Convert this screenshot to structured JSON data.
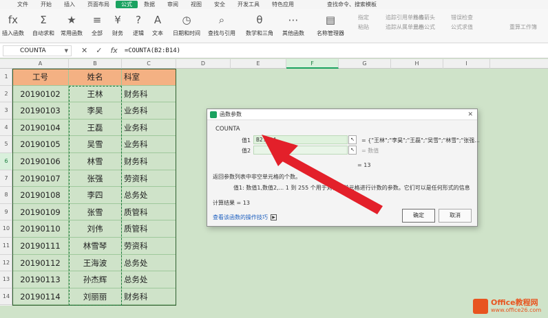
{
  "menubar": {
    "items": [
      "文件",
      "开始",
      "插入",
      "页面布局",
      "公式",
      "数据",
      "审阅",
      "视图",
      "安全",
      "开发工具",
      "特色应用"
    ],
    "active_index": 4,
    "search_text": "查找命令、搜索模板"
  },
  "toolbar": {
    "buttons": [
      {
        "label": "插入函数",
        "icon": "fx-icon",
        "glyph": "fx"
      },
      {
        "label": "自动求和",
        "icon": "sum-icon",
        "glyph": "Σ"
      },
      {
        "label": "常用函数",
        "icon": "star-icon",
        "glyph": "★"
      },
      {
        "label": "全部",
        "icon": "list-icon",
        "glyph": "≡"
      },
      {
        "label": "财务",
        "icon": "finance-icon",
        "glyph": "¥"
      },
      {
        "label": "逻辑",
        "icon": "logic-icon",
        "glyph": "?"
      },
      {
        "label": "文本",
        "icon": "text-icon",
        "glyph": "A"
      },
      {
        "label": "日期和时间",
        "icon": "clock-icon",
        "glyph": "◷"
      },
      {
        "label": "查找与引用",
        "icon": "search-icon",
        "glyph": "⌕"
      },
      {
        "label": "数学和三角",
        "icon": "math-icon",
        "glyph": "θ"
      },
      {
        "label": "其他函数",
        "icon": "more-icon",
        "glyph": "⋯"
      },
      {
        "label": "名称管理器",
        "icon": "name-icon",
        "glyph": "▤"
      }
    ],
    "small_items": [
      "指定",
      "粘贴",
      "追踪引用单元格",
      "追踪从属单元格",
      "移去箭头",
      "显示公式",
      "错误检查",
      "公式求值",
      "重算工作簿"
    ]
  },
  "formula_bar": {
    "name_box": "COUNTA",
    "formula": "=COUNTA(B2:B14)"
  },
  "grid": {
    "columns": [
      "A",
      "B",
      "C",
      "D",
      "E",
      "F",
      "G",
      "H",
      "I"
    ],
    "selected_column": "F",
    "rows": [
      "1",
      "2",
      "3",
      "4",
      "5",
      "6",
      "7",
      "8",
      "9",
      "10",
      "11",
      "12",
      "13",
      "14"
    ],
    "selected_row": "6",
    "header": [
      "工号",
      "姓名",
      "科室"
    ],
    "data": [
      [
        "20190102",
        "王林",
        "财务科"
      ],
      [
        "20190103",
        "李昊",
        "业务科"
      ],
      [
        "20190104",
        "王磊",
        "业务科"
      ],
      [
        "20190105",
        "吴雪",
        "业务科"
      ],
      [
        "20190106",
        "林雪",
        "财务科"
      ],
      [
        "20190107",
        "张强",
        "劳资科"
      ],
      [
        "20190108",
        "李四",
        "总务处"
      ],
      [
        "20190109",
        "张雪",
        "质管科"
      ],
      [
        "20190110",
        "刘伟",
        "质管科"
      ],
      [
        "20190111",
        "林雪琴",
        "劳资科"
      ],
      [
        "20190112",
        "王海波",
        "总务处"
      ],
      [
        "20190113",
        "孙杰辉",
        "总务处"
      ],
      [
        "20190114",
        "刘丽丽",
        "财务科"
      ]
    ]
  },
  "dialog": {
    "title": "函数参数",
    "function_name": "COUNTA",
    "arg1_label": "值1",
    "arg1_value": "B2:B14",
    "arg1_result": "= {\"王林\";\"李昊\";\"王磊\";\"吴雪\";\"林雪\";\"张强...",
    "arg2_label": "值2",
    "arg2_value": "",
    "arg2_result": "= 数值",
    "result": "= 13",
    "description": "返回参数列表中非空单元格的个数。",
    "arg_description": "值1:  数值1,数值2,... 1 到 255 个用于对值和单元格进行计数的参数。它们可以是任何形式的信息",
    "calc_result": "计算结果 = 13",
    "help_link": "查看该函数的操作技巧",
    "ok": "确定",
    "cancel": "取消"
  },
  "watermark": {
    "line1": "Office教程网",
    "line2": "www.office26.com"
  },
  "accent": "#1aa260"
}
